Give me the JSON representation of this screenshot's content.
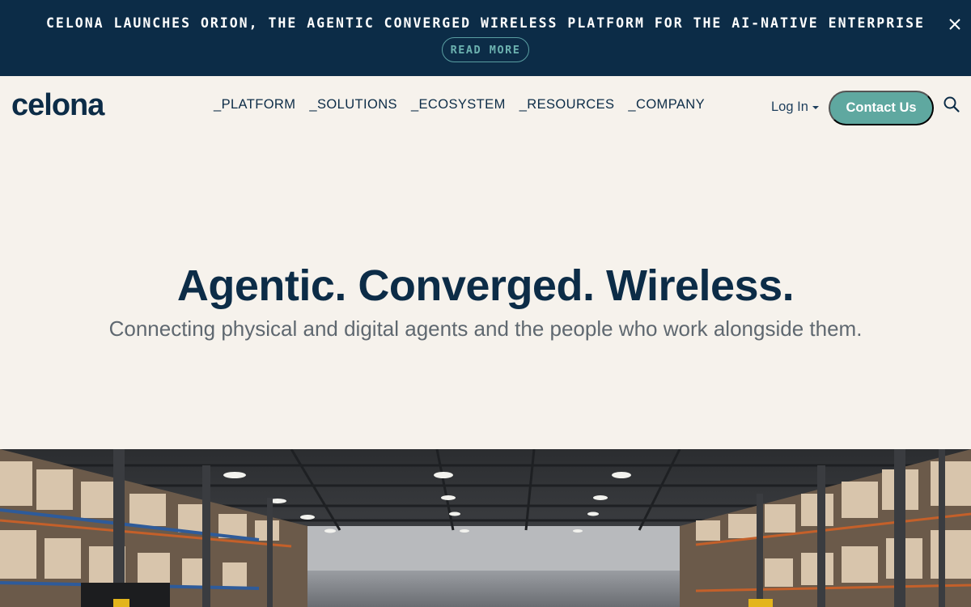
{
  "banner": {
    "text": "CELONA LAUNCHES ORION, THE AGENTIC CONVERGED WIRELESS PLATFORM FOR THE AI-NATIVE ENTERPRISE",
    "read_more": "READ MORE",
    "close_icon": "close-icon"
  },
  "header": {
    "logo_text": "celona",
    "nav": [
      "_PLATFORM",
      "_SOLUTIONS",
      "_ECOSYSTEM",
      "_RESOURCES",
      "_COMPANY"
    ],
    "login": "Log In",
    "contact": "Contact Us",
    "search_icon": "search-icon"
  },
  "hero": {
    "title": "Agentic. Converged. Wireless.",
    "subtitle": "Connecting physical and digital agents and the people who work alongside them."
  },
  "colors": {
    "navy": "#0c2c47",
    "teal": "#5fa8a0",
    "background": "#f6f2ec"
  }
}
